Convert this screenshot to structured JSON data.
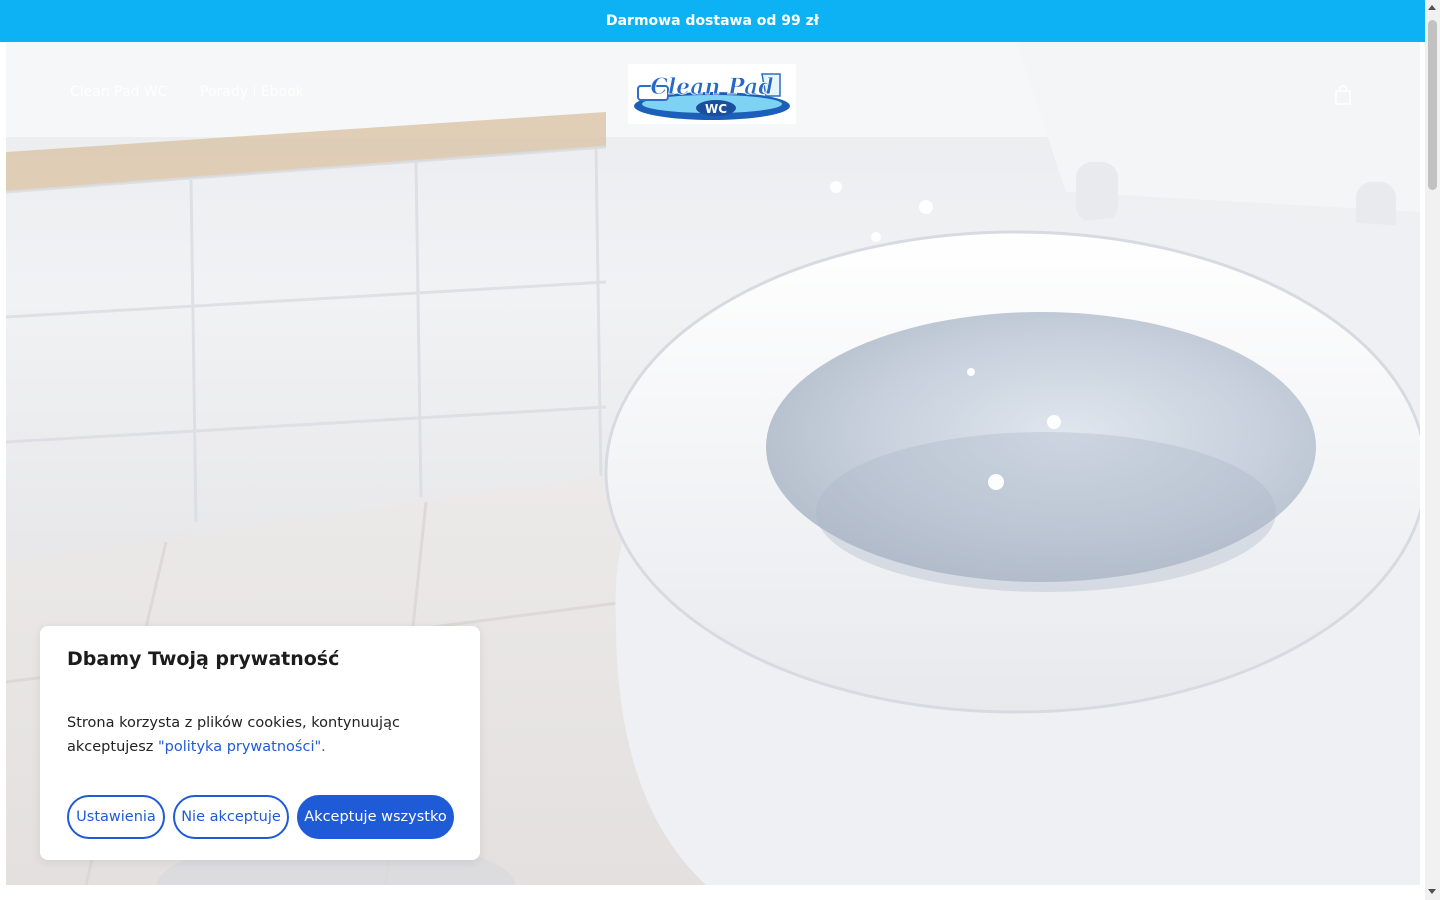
{
  "announcement": {
    "text": "Darmowa dostawa od 99 zł"
  },
  "header": {
    "nav": [
      {
        "label": "Clean Pad WC"
      },
      {
        "label": "Porady i Ebook"
      }
    ],
    "logo": {
      "line1": "Clean Pad",
      "line2": "WC"
    },
    "cart_icon": "shopping-bag-icon"
  },
  "cookie": {
    "title": "Dbamy Twoją prywatność",
    "text": "Strona korzysta z plików cookies, kontynuując akceptujesz ",
    "link": "\"polityka prywatności\".",
    "buttons": {
      "settings": "Ustawienia",
      "reject": "Nie akceptuje",
      "accept": "Akceptuje wszystko"
    }
  },
  "colors": {
    "announcement_bg": "#0db2f5",
    "primary": "#1f5bd6"
  }
}
